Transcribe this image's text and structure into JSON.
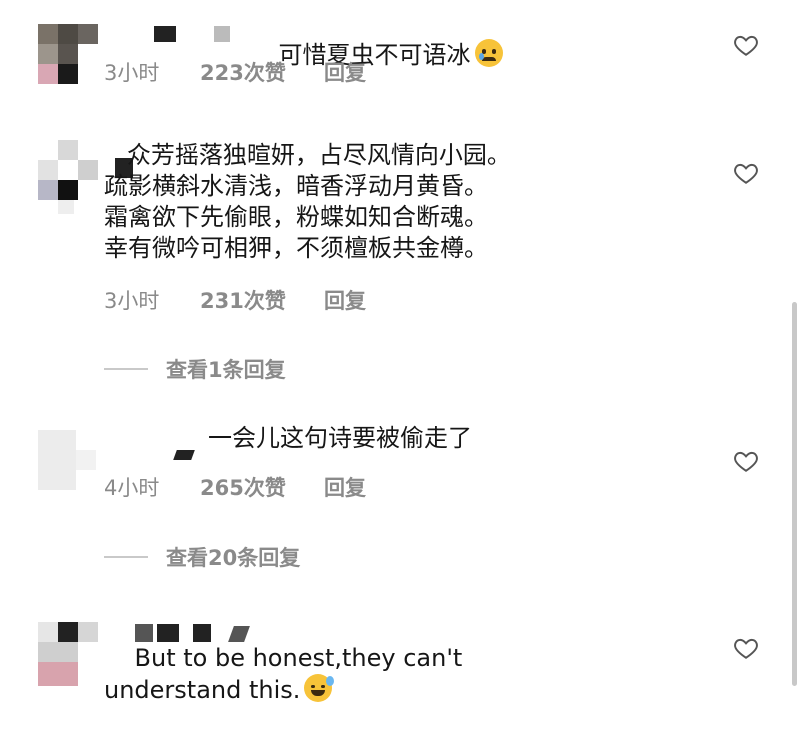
{
  "comments": [
    {
      "text": "可惜夏虫不可语冰",
      "emoji": "crying-face",
      "time": "3小时",
      "likes": "223次赞",
      "reply": "回复"
    },
    {
      "text": "   众芳摇落独暄妍，占尽风情向小园。\n疏影横斜水清浅，暗香浮动月黄昏。\n霜禽欲下先偷眼，粉蝶如知合断魂。\n幸有微吟可相狎，不须檀板共金樽。",
      "time": "3小时",
      "likes": "231次赞",
      "reply": "回复",
      "view_replies": "查看1条回复"
    },
    {
      "text": "一会儿这句诗要被偷走了",
      "time": "4小时",
      "likes": "265次赞",
      "reply": "回复",
      "view_replies": "查看20条回复"
    },
    {
      "text": "But to be honest,they can't\nunderstand this.",
      "emoji": "sweat-smile-face"
    }
  ],
  "colors": {
    "meta": "#8a8a8a",
    "text": "#161616",
    "heart_stroke": "#555555"
  }
}
